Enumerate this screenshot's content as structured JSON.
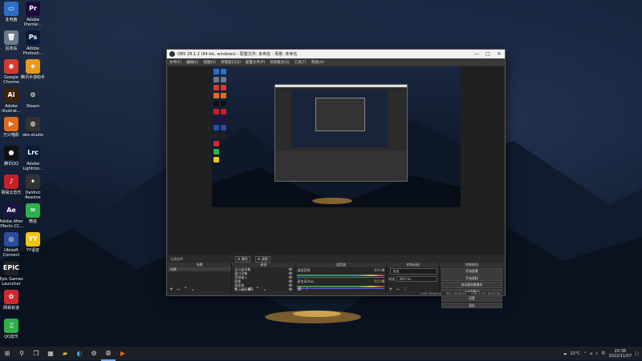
{
  "desktop": {
    "icons": [
      {
        "label": "此电脑",
        "glyph": "▭",
        "color": "#2d6fc4"
      },
      {
        "label": "回收站",
        "glyph": "🗑",
        "color": "#6a7b8c"
      },
      {
        "label": "Google Chrome",
        "glyph": "◉",
        "color": "#d23b2f"
      },
      {
        "label": "Adobe Illustrat...",
        "glyph": "Ai",
        "color": "#3b2409"
      },
      {
        "label": "万兴喵影",
        "glyph": "▶",
        "color": "#e06b1a"
      },
      {
        "label": "腾讯QQ",
        "glyph": "●",
        "color": "#111"
      },
      {
        "label": "网易云音乐",
        "glyph": "♪",
        "color": "#c8202a"
      },
      {
        "label": "Adobe After Effects CC...",
        "glyph": "Ae",
        "color": "#1c1346"
      },
      {
        "label": "Ubisoft Connect",
        "glyph": "◎",
        "color": "#2b4b9b"
      },
      {
        "label": "Epic Games Launcher",
        "glyph": "EPIC",
        "color": "#222"
      },
      {
        "label": "网易有道",
        "glyph": "✿",
        "color": "#d02832"
      },
      {
        "label": "QQ音乐",
        "glyph": "♫",
        "color": "#30b04a"
      },
      {
        "label": "Adobe Premie...",
        "glyph": "Pr",
        "color": "#1d0a3d"
      },
      {
        "label": "Adobe Photosh...",
        "glyph": "Ps",
        "color": "#061d3a"
      },
      {
        "label": "腾讯手游助手",
        "glyph": "◈",
        "color": "#e89a20"
      },
      {
        "label": "Steam",
        "glyph": "⚙",
        "color": "#1b2838"
      },
      {
        "label": "obs-studio",
        "glyph": "◍",
        "color": "#333"
      },
      {
        "label": "Adobe Lightroo...",
        "glyph": "Lrc",
        "color": "#071d33"
      },
      {
        "label": "DaVinci Resolve",
        "glyph": "✦",
        "color": "#333"
      },
      {
        "label": "微信",
        "glyph": "✉",
        "color": "#2bb24c"
      },
      {
        "label": "YY语音",
        "glyph": "YY",
        "color": "#f1c40f"
      }
    ]
  },
  "window": {
    "title": "OBS 28.1.2 (64-bit, windows) - 配置文件: 未命名 - 场景: 未命名",
    "minimize": "—",
    "maximize": "□",
    "close": "✕",
    "menu": [
      "文件(F)",
      "编辑(E)",
      "视图(V)",
      "停靠窗口(D)",
      "配置文件(P)",
      "场景集合(S)",
      "工具(T)",
      "帮助(H)"
    ]
  },
  "source_bar": {
    "label": "无源选择",
    "properties": "属性",
    "filters": "滤镜"
  },
  "docks": {
    "scenes": {
      "header": "场景",
      "items": [
        "场景"
      ]
    },
    "sources": {
      "header": "来源",
      "items": [
        "显示器采集",
        "窗口采集",
        "音频输入",
        "图像",
        "媒体源",
        "显示器采集 2"
      ]
    },
    "mixer": {
      "header": "混音器",
      "channels": [
        {
          "name": "桌面音频",
          "db": "0.0 dB"
        },
        {
          "name": "麦克风/Aux",
          "db": "0.0 dB"
        }
      ]
    },
    "transitions": {
      "header": "转场动画",
      "type": "淡出",
      "duration_label": "时长",
      "duration_value": "300 ms"
    },
    "controls": {
      "header": "控制按钮",
      "buttons": [
        "开始直播",
        "开始录制",
        "启动虚拟摄像机",
        "工作室模式",
        "设置",
        "退出"
      ]
    }
  },
  "status": {
    "live": "LIVE: 00:00:00",
    "rec": "REC: 00:00:00",
    "cpu": "CPU: 4.2%, 60.00 fps"
  },
  "taskbar": {
    "weather": "22°C",
    "ime": "中",
    "time": "20:38",
    "date": "2022/11/07"
  }
}
